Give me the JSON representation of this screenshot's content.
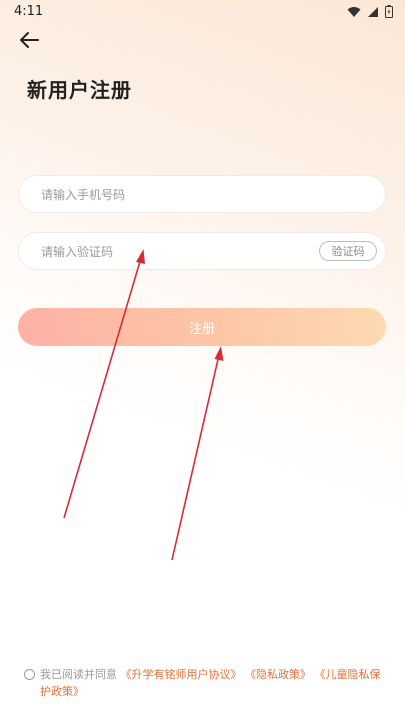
{
  "status_bar": {
    "time": "4:11",
    "icons": [
      "wifi-icon",
      "signal-icon",
      "battery-icon"
    ]
  },
  "header": {
    "back_icon": "arrow-left-icon",
    "title": "新用户注册"
  },
  "form": {
    "phone_placeholder": "请输入手机号码",
    "phone_value": "",
    "code_placeholder": "请输入验证码",
    "code_value": "",
    "code_button": "验证码",
    "register_button": "注册"
  },
  "agreement": {
    "prefix": "我已阅读并同意",
    "links": [
      "《升学有铭师用户协议》",
      "《隐私政策》",
      "《儿童隐私保护政策》"
    ],
    "checked": false
  },
  "colors": {
    "accent_link": "#e8703a",
    "register_gradient_start": "#fdb1a6",
    "register_gradient_end": "#fed9b2",
    "annotation_arrow": "#d92b37"
  }
}
